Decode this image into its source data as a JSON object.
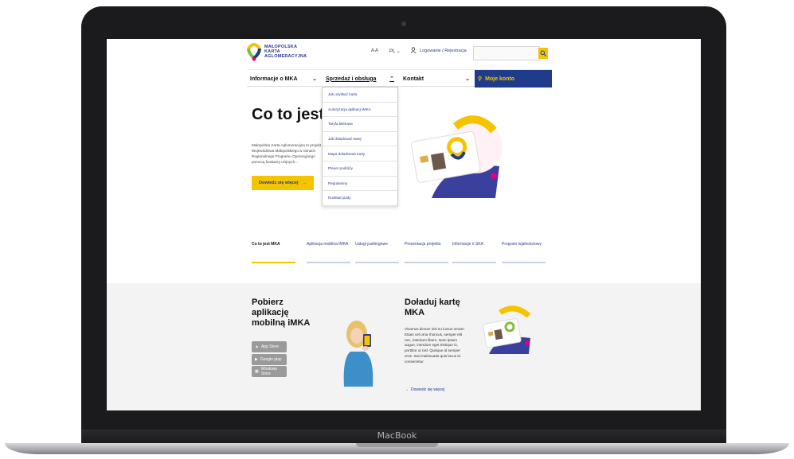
{
  "device": {
    "brand": "MacBook"
  },
  "header": {
    "logo_lines": [
      "MAŁOPOLSKA",
      "KARTA",
      "AGLOMERACYJNA"
    ],
    "font_size_label": "A A",
    "language": "PL",
    "login_label": "Logowanie / Rejestracja",
    "search_placeholder": ""
  },
  "nav": {
    "items": [
      {
        "label": "Informacje o MKA"
      },
      {
        "label": "Sprzedaż i obsługa"
      },
      {
        "label": "Kontakt"
      }
    ],
    "account_label": "Moje konto"
  },
  "dropdown": {
    "items": [
      "Jak uzyskać kartę",
      "Autoryzacja aplikacji iMKA",
      "Taryfa biletowa",
      "Jak doładować kartę",
      "Mapa doładowań karty",
      "Planer podróży",
      "Regulaminy",
      "Rozkład jazdy"
    ]
  },
  "hero": {
    "title": "Co to jest",
    "text": "Małopolska Karta Aglomeracyjna to projekt Województwa Małopolskiego w ramach Regionalnego Programu Operacyjnego pomocą funduszy unijnych...",
    "cta": "Dowiedz się więcej"
  },
  "tabs": [
    {
      "label": "Co to jest MKA"
    },
    {
      "label": "Aplikacja mobilna iMKA"
    },
    {
      "label": "Usługi parkingowe"
    },
    {
      "label": "Prezentacja projektu"
    },
    {
      "label": "Informacje o SKA"
    },
    {
      "label": "Program lojalnościowy"
    }
  ],
  "app_section": {
    "title": "Pobierz aplikację mobilną iMKA",
    "badges": [
      "App Store",
      "Google play",
      "Windows Store"
    ]
  },
  "topup_section": {
    "title": "Doładuj kartę MKA",
    "text": "Vivamus dictum nisl eu luctus ornare. Etiam vel urna rhoncus, semper elit nec, interdum libero. Nam ipsum augue, interdum eget tristique in, porttitor ut nisl. Quisque id semper eros. Sed malesuada quis lacus id consectetur.",
    "link": "Dowiedz się więcej"
  },
  "colors": {
    "brand_blue": "#1f3b8c",
    "brand_yellow": "#f5c400",
    "brand_green": "#7bbf3a",
    "brand_pink": "#e4007c"
  }
}
